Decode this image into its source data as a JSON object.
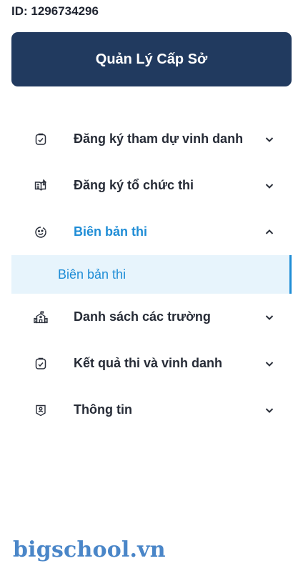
{
  "account": {
    "id_text": "ID: 1296734296"
  },
  "header": {
    "role_title": "Quản Lý Cấp Sở"
  },
  "menu": {
    "items": [
      {
        "label": "Đăng ký tham dự vinh danh",
        "icon": "clipboard-check-icon",
        "expanded": false
      },
      {
        "label": "Đăng ký tổ chức thi",
        "icon": "open-book-icon",
        "expanded": false
      },
      {
        "label": "Biên bản thi",
        "icon": "smile-face-icon",
        "expanded": true,
        "active": true,
        "children": [
          {
            "label": "Biên bản thi",
            "selected": true
          }
        ]
      },
      {
        "label": "Danh sách các trường",
        "icon": "school-building-icon",
        "expanded": false
      },
      {
        "label": "Kết quả thi và vinh danh",
        "icon": "clipboard-check-icon",
        "expanded": false
      },
      {
        "label": "Thông tin",
        "icon": "id-badge-icon",
        "expanded": false
      }
    ]
  },
  "watermark": {
    "text": "bigschool.vn"
  },
  "colors": {
    "banner": "#213a5f",
    "accent": "#1f8dd6",
    "submenu_bg": "#e7f4fc",
    "logo": "#4a86c8"
  }
}
